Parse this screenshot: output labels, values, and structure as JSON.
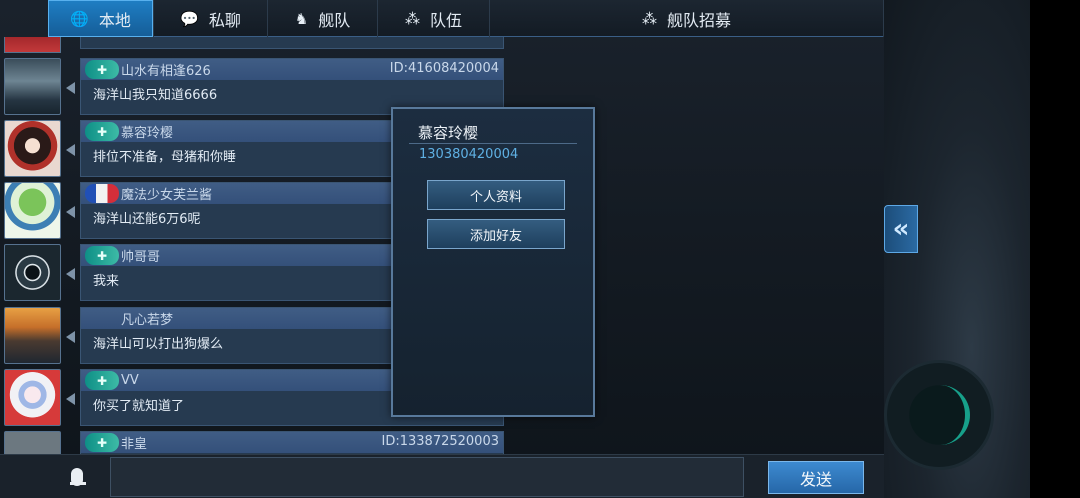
{
  "tabs": [
    {
      "label": "本地",
      "icon": "globe-icon",
      "glyph": "🌐"
    },
    {
      "label": "私聊",
      "icon": "speech-bubble-icon",
      "glyph": "💬"
    },
    {
      "label": "舰队",
      "icon": "fleet-icon",
      "glyph": "♞"
    },
    {
      "label": "队伍",
      "icon": "team-icon",
      "glyph": "⁂"
    },
    {
      "label": "舰队招募",
      "icon": "team-icon",
      "glyph": "⁂"
    }
  ],
  "messages": [
    {
      "sender": "山水有相逢626",
      "player_id": "ID:41608420004",
      "text": "海洋山我只知道6666",
      "flag": "cn"
    },
    {
      "sender": "慕容玲樱",
      "player_id": "",
      "text": "排位不准备，母猪和你睡",
      "flag": "cn"
    },
    {
      "sender": "魔法少女芙兰酱",
      "player_id": "",
      "text": "海洋山还能6万6呢",
      "flag": "fr"
    },
    {
      "sender": "帅哥哥",
      "player_id": "",
      "text": "我来",
      "flag": "cn"
    },
    {
      "sender": "凡心若梦",
      "player_id": "",
      "text": "海洋山可以打出狗爆么",
      "flag": "none"
    },
    {
      "sender": "VV",
      "player_id": "",
      "text": "你买了就知道了",
      "flag": "cn"
    },
    {
      "sender": "非皇",
      "player_id": "ID:133872520003",
      "text": "",
      "flag": "cn"
    }
  ],
  "popup": {
    "name": "慕容玲樱",
    "player_id": "130380420004",
    "profile_label": "个人资料",
    "add_friend_label": "添加好友"
  },
  "input": {
    "placeholder": "",
    "value": ""
  },
  "send_label": "发送",
  "colors": {
    "accent": "#1f7ec4",
    "panel": "#263a50",
    "id_text": "#5fb0e3"
  }
}
